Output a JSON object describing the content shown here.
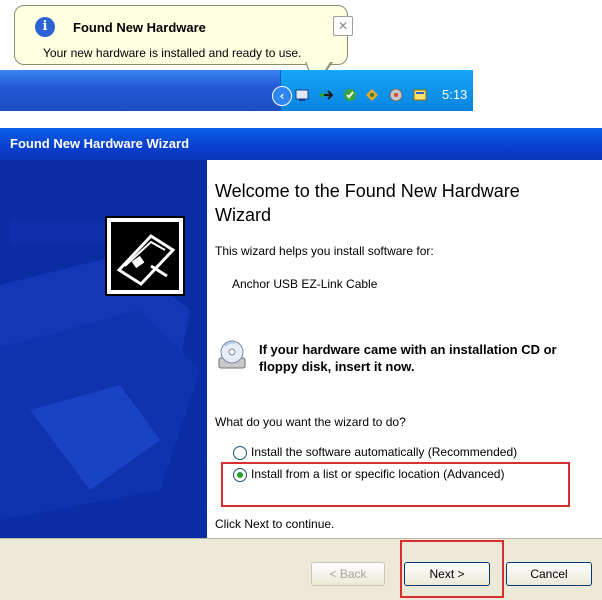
{
  "balloon": {
    "title": "Found New Hardware",
    "message": "Your new hardware is installed and ready to use.",
    "close_symbol": "✕",
    "info_symbol": "i"
  },
  "taskbar": {
    "clock": "5:13",
    "tray_arrow_symbol": "‹",
    "tray_icons": [
      "network-icon",
      "safely-remove-icon",
      "security-icon",
      "updates-icon",
      "antivirus-icon",
      "messenger-icon"
    ]
  },
  "wizard": {
    "title": "Found New Hardware Wizard",
    "welcome_title": "Welcome to the Found New Hardware Wizard",
    "intro": "This wizard helps you install software for:",
    "device_name": "Anchor USB EZ-Link Cable",
    "cd_prompt": "If your hardware came with an installation CD or floppy disk, insert it now.",
    "question": "What do you want the wizard to do?",
    "options": [
      {
        "label": "Install the software automatically (Recommended)",
        "selected": false
      },
      {
        "label": "Install from a list or specific location (Advanced)",
        "selected": true
      }
    ],
    "continue_text": "Click Next to continue.",
    "buttons": {
      "back": "< Back",
      "next": "Next >",
      "cancel": "Cancel"
    }
  },
  "colors": {
    "highlight": "#d83030",
    "titlebar": "#0a50d9",
    "left_panel": "#0a2da6",
    "balloon_bg": "#ffffe1"
  }
}
